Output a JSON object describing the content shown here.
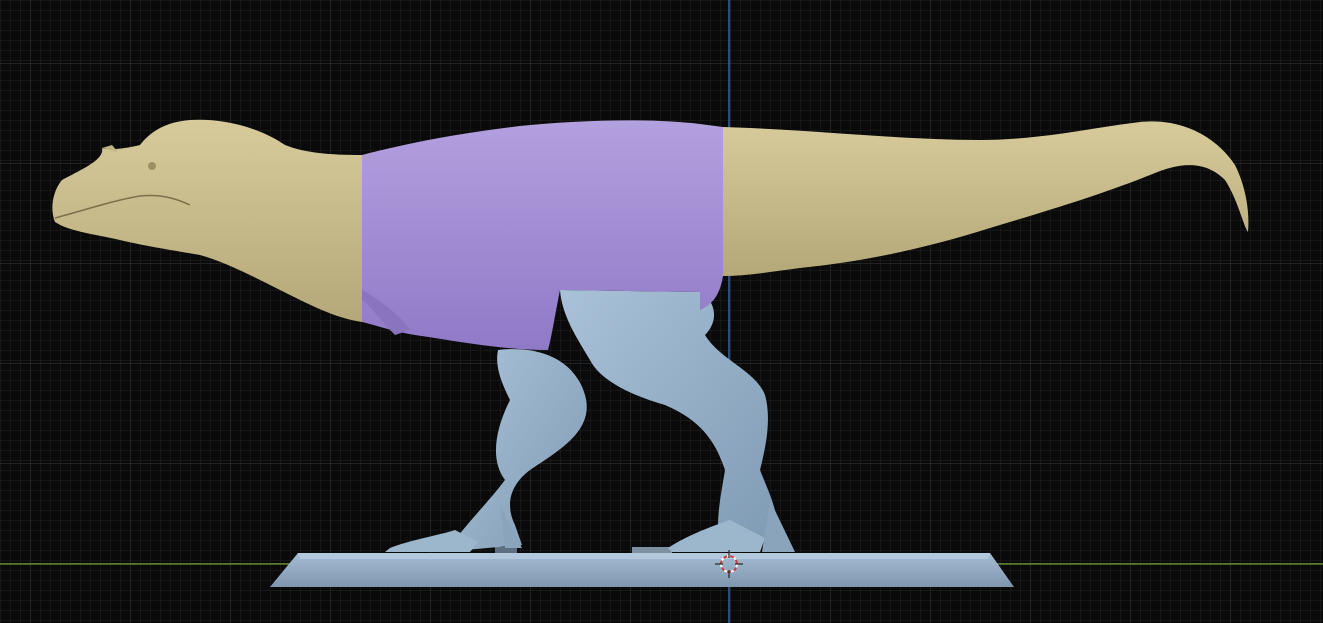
{
  "viewport": {
    "view": "orthographic-side",
    "grid": true
  },
  "colors": {
    "background": "#0a0a0a",
    "grid_minor": "#2b2b2b",
    "grid_major": "#3a3a3a",
    "axis_z": "#3f78c9",
    "axis_y": "#6e9a2e",
    "cursor": "#d33b3b",
    "part_head_tail": "#cdbf8e",
    "part_torso": "#a690d6",
    "part_legs_base": "#9ab4cc"
  },
  "scene_parts": [
    {
      "name": "head-neck-section",
      "color_key": "part_head_tail"
    },
    {
      "name": "torso-section",
      "color_key": "part_torso"
    },
    {
      "name": "tail-section",
      "color_key": "part_head_tail"
    },
    {
      "name": "legs-section",
      "color_key": "part_legs_base"
    },
    {
      "name": "display-base",
      "color_key": "part_legs_base"
    }
  ],
  "icons": [
    "3d-cursor-icon"
  ]
}
